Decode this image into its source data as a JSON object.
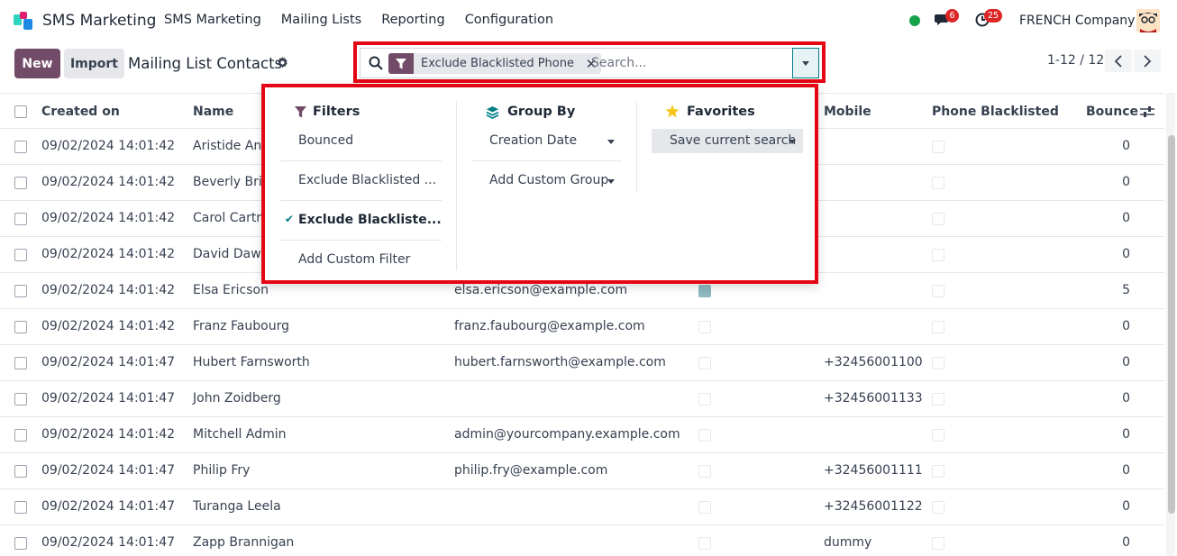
{
  "navbar": {
    "app_name": "SMS Marketing",
    "menu": [
      "SMS Marketing",
      "Mailing Lists",
      "Reporting",
      "Configuration"
    ],
    "chat_count": "6",
    "activity_count": "25",
    "company": "FRENCH Company"
  },
  "control": {
    "new_label": "New",
    "import_label": "Import",
    "title": "Mailing List Contacts",
    "facet_label": "Exclude Blacklisted Phone",
    "search_placeholder": "Search...",
    "pager": "1-12 / 12"
  },
  "table": {
    "headers": {
      "created_on": "Created on",
      "name": "Name",
      "mobile": "Mobile",
      "phone_blacklisted": "Phone Blacklisted",
      "bounce": "Bounce"
    },
    "rows": [
      {
        "created": "09/02/2024 14:01:42",
        "name": "Aristide Ant",
        "email": "",
        "email_bl": false,
        "mobile": "",
        "bounce": "0"
      },
      {
        "created": "09/02/2024 14:01:42",
        "name": "Beverly Brid",
        "email": "",
        "email_bl": false,
        "mobile": "",
        "bounce": "0"
      },
      {
        "created": "09/02/2024 14:01:42",
        "name": "Carol Cartric",
        "email": "",
        "email_bl": false,
        "mobile": "",
        "bounce": "0"
      },
      {
        "created": "09/02/2024 14:01:42",
        "name": "David Dawso",
        "email": "",
        "email_bl": false,
        "mobile": "",
        "bounce": "0"
      },
      {
        "created": "09/02/2024 14:01:42",
        "name": "Elsa Ericson",
        "email": "elsa.ericson@example.com",
        "email_bl": true,
        "mobile": "",
        "bounce": "5"
      },
      {
        "created": "09/02/2024 14:01:42",
        "name": "Franz Faubourg",
        "email": "franz.faubourg@example.com",
        "email_bl": false,
        "mobile": "",
        "bounce": "0"
      },
      {
        "created": "09/02/2024 14:01:47",
        "name": "Hubert Farnsworth",
        "email": "hubert.farnsworth@example.com",
        "email_bl": false,
        "mobile": "+32456001100",
        "bounce": "0"
      },
      {
        "created": "09/02/2024 14:01:47",
        "name": "John Zoidberg",
        "email": "",
        "email_bl": false,
        "mobile": "+32456001133",
        "bounce": "0"
      },
      {
        "created": "09/02/2024 14:01:42",
        "name": "Mitchell Admin",
        "email": "admin@yourcompany.example.com",
        "email_bl": false,
        "mobile": "",
        "bounce": "0"
      },
      {
        "created": "09/02/2024 14:01:47",
        "name": "Philip Fry",
        "email": "philip.fry@example.com",
        "email_bl": false,
        "mobile": "+32456001111",
        "bounce": "0"
      },
      {
        "created": "09/02/2024 14:01:47",
        "name": "Turanga Leela",
        "email": "",
        "email_bl": false,
        "mobile": "+32456001122",
        "bounce": "0"
      },
      {
        "created": "09/02/2024 14:01:47",
        "name": "Zapp Brannigan",
        "email": "",
        "email_bl": false,
        "mobile": "dummy",
        "bounce": "0"
      }
    ]
  },
  "dropdown": {
    "filters": {
      "title": "Filters",
      "items": [
        "Bounced",
        "Exclude Blacklisted ...",
        "Exclude Blackliste...",
        "Add Custom Filter"
      ]
    },
    "group_by": {
      "title": "Group By",
      "items": [
        "Creation Date",
        "Add Custom Group"
      ]
    },
    "favorites": {
      "title": "Favorites",
      "items": [
        "Save current search"
      ]
    }
  },
  "colors": {
    "brand": "#714b67",
    "highlight": "#e40613",
    "teal": "#017e84",
    "green_dot": "#16a34a",
    "badge": "#dc2626"
  }
}
